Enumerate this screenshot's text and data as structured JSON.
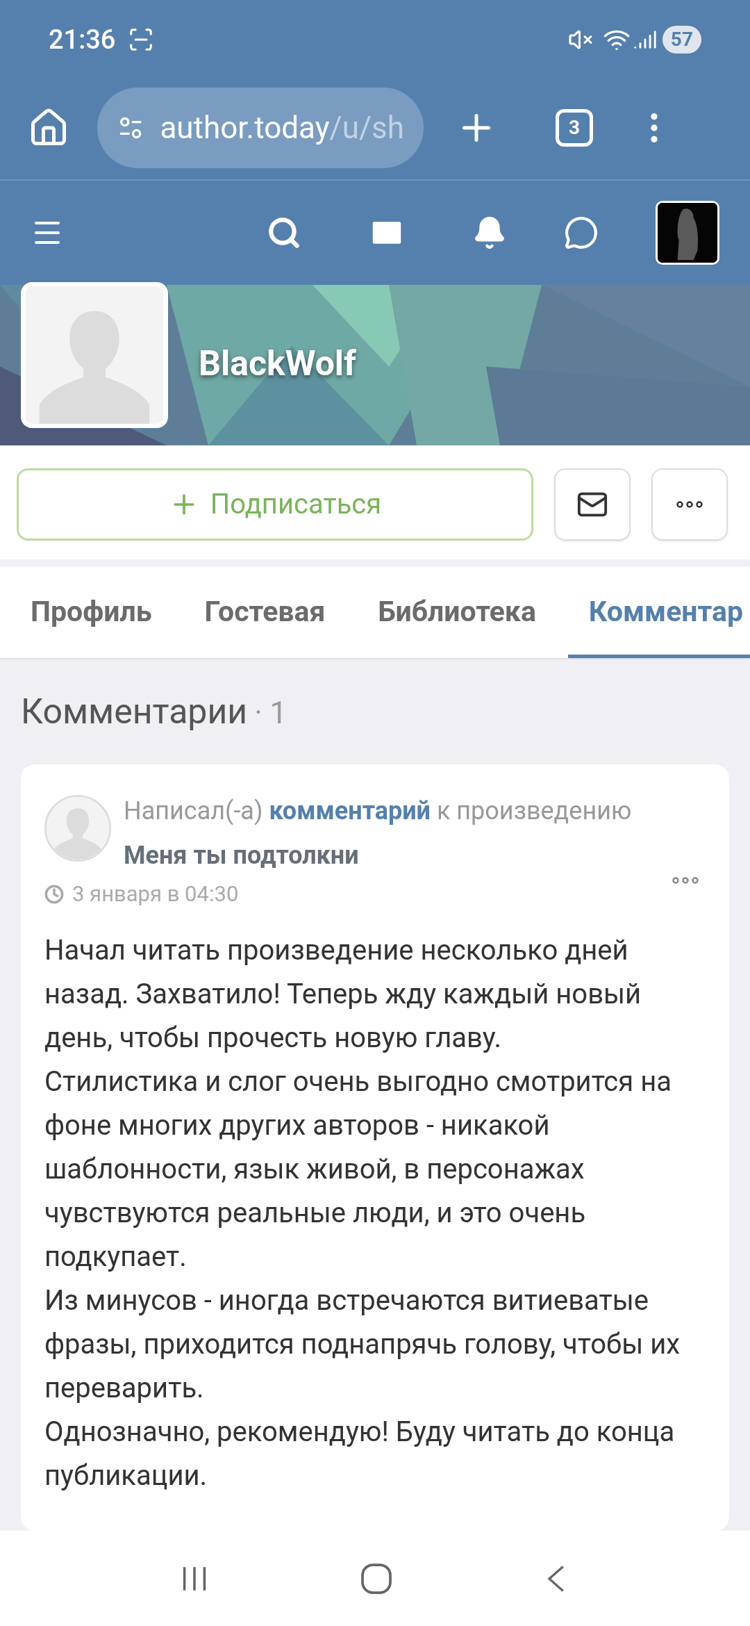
{
  "status_bar": {
    "time": "21:36",
    "battery": "57"
  },
  "browser": {
    "url_host": "author.today",
    "url_path": "/u/sh",
    "tab_count": "3"
  },
  "profile": {
    "name": "BlackWolf",
    "subscribe_label": "Подписаться"
  },
  "tabs": [
    {
      "label": "Профиль",
      "selected": false
    },
    {
      "label": "Гостевая",
      "selected": false
    },
    {
      "label": "Библиотека",
      "selected": false
    },
    {
      "label": "Комментар",
      "selected": true
    }
  ],
  "section": {
    "title": "Комментарии",
    "count": "· 1"
  },
  "comment": {
    "header": "Написал(-а) **комментарий** к произведению",
    "work_title": "Меня ты подтолкни",
    "date": "3 января в 04:30",
    "paragraphs": [
      "Начал читать произведение несколько дней назад. Захватило! Теперь жду каждый новый день, чтобы прочесть новую главу.",
      "Стилистика и слог очень выгодно смотрится на фоне многих других авторов - никакой шаблонности, язык живой, в персонажах чувствуются реальные люди, и это очень подкупает.",
      "Из минусов - иногда встречаются витиеватые фразы, приходится поднапрячь голову, чтобы их переварить.",
      "Однозначно, рекомендую! Буду читать до конца публикации."
    ]
  }
}
